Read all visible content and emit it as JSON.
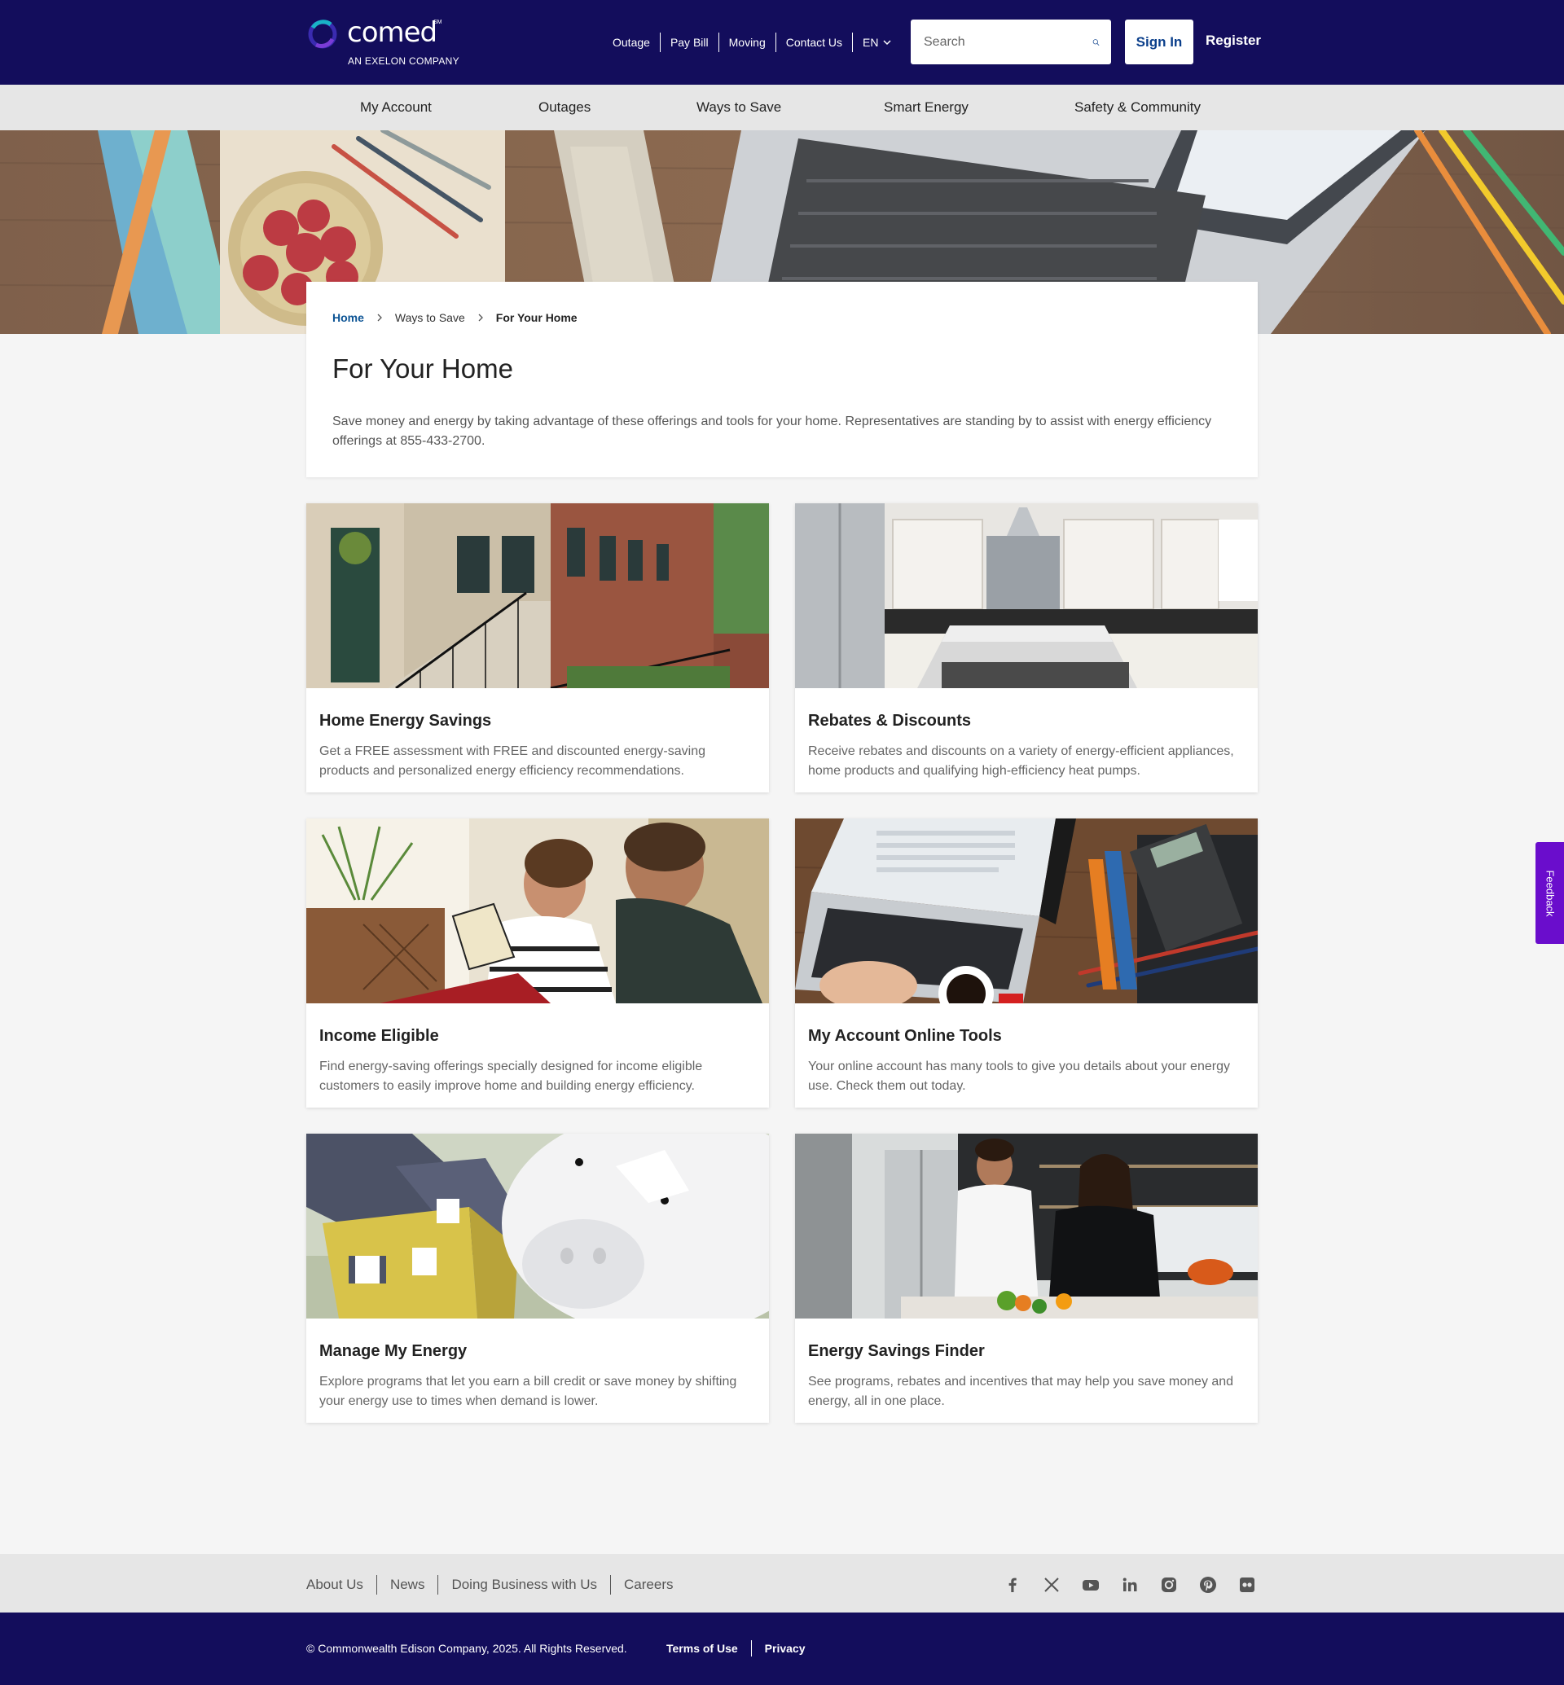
{
  "brand": {
    "name": "comed",
    "sm": "SM",
    "tagline": "AN EXELON COMPANY",
    "primary_color": "#130d5c",
    "accent_color": "#6a0dcc"
  },
  "utility_nav": [
    "Outage",
    "Pay Bill",
    "Moving",
    "Contact Us"
  ],
  "language": "EN",
  "search": {
    "placeholder": "Search",
    "icon": "search-icon"
  },
  "auth": {
    "signin_label": "Sign In",
    "register_label": "Register"
  },
  "main_nav": [
    "My Account",
    "Outages",
    "Ways to Save",
    "Smart Energy",
    "Safety & Community"
  ],
  "breadcrumb": {
    "home": "Home",
    "parent": "Ways to Save",
    "current": "For Your Home"
  },
  "page": {
    "title": "For Your Home",
    "intro": "Save money and energy by taking advantage of these offerings and tools for your home. Representatives are standing by to assist with energy efficiency offerings at 855-433-2700."
  },
  "cards": [
    {
      "title": "Home Energy Savings",
      "description": "Get a FREE assessment with FREE and discounted energy-saving products and personalized energy efficiency recommendations."
    },
    {
      "title": "Rebates & Discounts",
      "description": "Receive rebates and discounts on a variety of energy-efficient appliances, home products and qualifying high-efficiency heat pumps."
    },
    {
      "title": "Income Eligible",
      "description": "Find energy-saving offerings specially designed for income eligible customers to easily improve home and building energy efficiency."
    },
    {
      "title": "My Account Online Tools",
      "description": "Your online account has many tools to give you details about your energy use. Check them out today."
    },
    {
      "title": "Manage My Energy",
      "description": "Explore programs that let you earn a bill credit or save money by shifting your energy use to times when demand is lower."
    },
    {
      "title": "Energy Savings Finder",
      "description": "See programs, rebates and incentives that may help you save money and energy, all in one place."
    }
  ],
  "feedback_label": "Feedback",
  "footer": {
    "links": [
      "About Us",
      "News",
      "Doing Business with Us",
      "Careers"
    ],
    "social_icons": [
      "facebook-icon",
      "x-icon",
      "youtube-icon",
      "linkedin-icon",
      "instagram-icon",
      "pinterest-icon",
      "flickr-icon"
    ],
    "copyright": "© Commonwealth Edison Company, 2025. All Rights Reserved.",
    "legal": [
      "Terms of Use",
      "Privacy"
    ]
  }
}
